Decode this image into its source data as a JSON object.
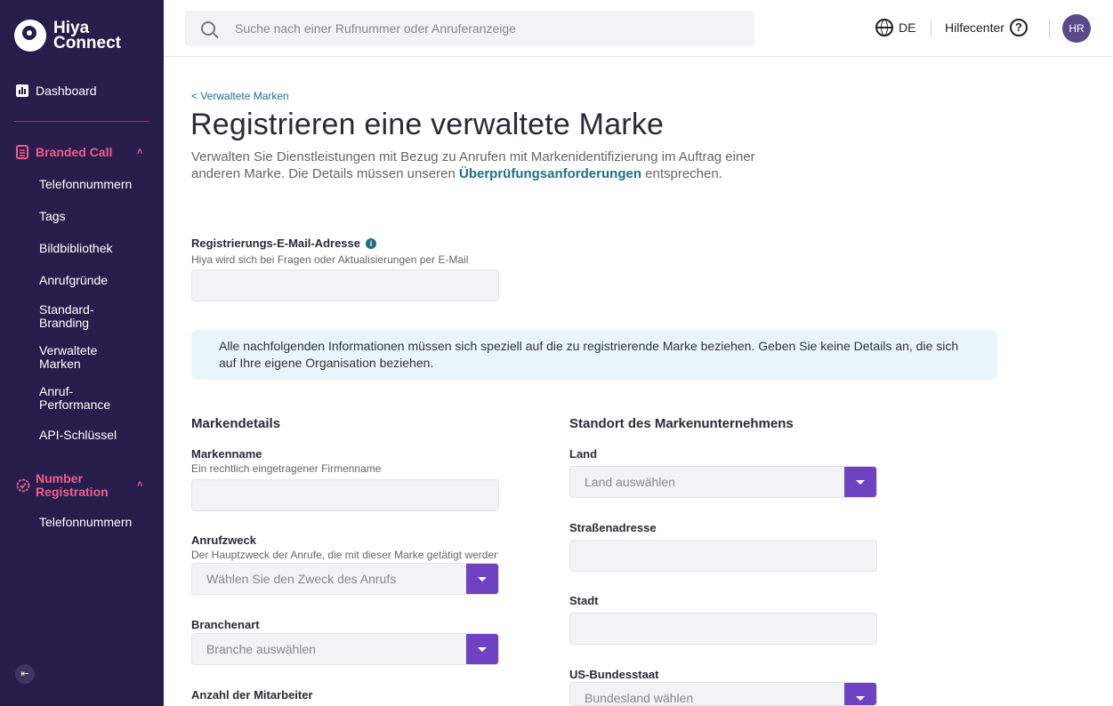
{
  "app": {
    "logo_line1": "Hiya",
    "logo_line2": "Connect"
  },
  "sidebar": {
    "dashboard": "Dashboard",
    "branded_call": {
      "label": "Branded Call",
      "items": [
        "Telefonnummern",
        "Tags",
        "Bildbibliothek",
        "Anrufgründe",
        "Standard-Branding",
        "Verwaltete Marken",
        "Anruf-Performance",
        "API-Schlüssel"
      ]
    },
    "number_registration": {
      "label": "Number Registration",
      "items": [
        "Telefonnummern"
      ]
    }
  },
  "topbar": {
    "search_placeholder": "Suche nach einer Rufnummer oder Anruferanzeige",
    "language": "DE",
    "help_label": "Hilfecenter",
    "avatar_initials": "HR"
  },
  "main": {
    "back_link": "< Verwaltete Marken",
    "title": "Registrieren eine verwaltete Marke",
    "intro_before": "Verwalten Sie Dienstleistungen mit Bezug zu Anrufen mit Markenidentifizierung im Auftrag einer anderen Marke. Die Details müssen unseren ",
    "intro_link": "Überprüfungsanforderungen",
    "intro_after": " entsprechen.",
    "email": {
      "label": "Registrierungs-E-Mail-Adresse",
      "hint": "Hiya wird sich bei Fragen oder Aktualisierungen per E-Mail",
      "value": ""
    },
    "notice": "Alle nachfolgenden Informationen müssen sich speziell auf die zu registrierende Marke beziehen. Geben Sie keine Details an, die sich auf Ihre eigene Organisation beziehen.",
    "brand_details": {
      "title": "Markendetails",
      "brand_name_label": "Markenname",
      "brand_name_hint": "Ein rechtlich eingetragener Firmenname",
      "brand_name_value": "",
      "call_purpose_label": "Anrufzweck",
      "call_purpose_hint": "Der Hauptzweck der Anrufe, die mit dieser Marke getätigt werden",
      "call_purpose_value": "Wählen Sie den Zweck des Anrufs",
      "industry_label": "Branchenart",
      "industry_value": "Branche auswählen",
      "employees_label": "Anzahl der Mitarbeiter"
    },
    "location": {
      "title": "Standort des Markenunternehmens",
      "country_label": "Land",
      "country_value": "Land auswählen",
      "street_label": "Straßenadresse",
      "street_value": "",
      "city_label": "Stadt",
      "city_value": "",
      "state_label": "US-Bundesstaat",
      "state_value": "Bundesland wählen"
    }
  }
}
